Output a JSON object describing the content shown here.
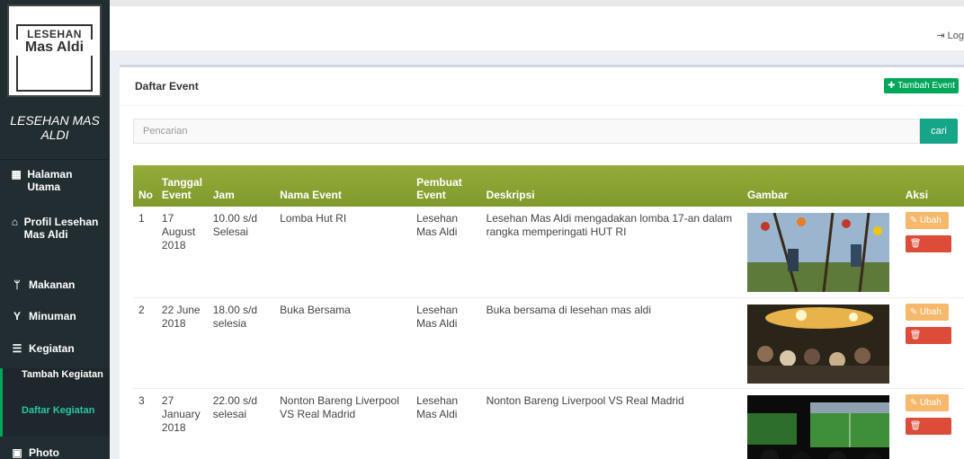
{
  "sidebar": {
    "logo_line1": "LESEHAN",
    "logo_line2": "Mas Aldi",
    "brand": "LESEHAN MAS ALDI",
    "menu": [
      {
        "icon": "grid-icon",
        "label": "Halaman Utama"
      },
      {
        "icon": "home-icon",
        "label": "Profil Lesehan Mas Aldi"
      },
      {
        "icon": "cutlery-icon",
        "label": "Makanan"
      },
      {
        "icon": "glass-icon",
        "label": "Minuman"
      },
      {
        "icon": "list-icon",
        "label": "Kegiatan"
      },
      {
        "icon": "picture-icon",
        "label": "Photo"
      }
    ],
    "submenu": [
      {
        "label": "Tambah Kegiatan"
      },
      {
        "label": "Daftar Kegiatan"
      }
    ]
  },
  "topbar": {
    "logout_label": "Log"
  },
  "box": {
    "title": "Daftar Event",
    "add_label": "Tambah Event",
    "search_placeholder": "Pencarian",
    "search_button": "cari"
  },
  "table": {
    "headers": [
      "No",
      "Tanggal Event",
      "Jam",
      "Nama Event",
      "Pembuat Event",
      "Deskripsi",
      "Gambar",
      "Aksi"
    ],
    "rows": [
      {
        "no": "1",
        "tanggal": "17 August 2018",
        "jam": "10.00 s/d Selesai",
        "nama": "Lomba Hut RI",
        "pembuat": "Lesehan Mas Aldi",
        "deskripsi": "Lesehan Mas Aldi mengadakan lomba 17-an dalam rangka memperingati HUT RI",
        "gambar": "panjat-pinang-photo"
      },
      {
        "no": "2",
        "tanggal": "22 June 2018",
        "jam": "18.00 s/d selesia",
        "nama": "Buka Bersama",
        "pembuat": "Lesehan Mas Aldi",
        "deskripsi": "Buka bersama di lesehan mas aldi",
        "gambar": "crowd-photo"
      },
      {
        "no": "3",
        "tanggal": "27 January 2018",
        "jam": "22.00 s/d selesai",
        "nama": "Nonton Bareng Liverpool VS Real Madrid",
        "pembuat": "Lesehan Mas Aldi",
        "deskripsi": "Nonton Bareng Liverpool VS Real Madrid",
        "gambar": "football-screen-photo"
      }
    ],
    "edit_label": "Ubah",
    "delete_label": "Hapus"
  },
  "colors": {
    "sidebar_bg": "#222d32",
    "header_green": "#8ba539",
    "add_button": "#00a65a",
    "edit_button": "#f6b86b",
    "delete_button": "#dd4b39"
  }
}
